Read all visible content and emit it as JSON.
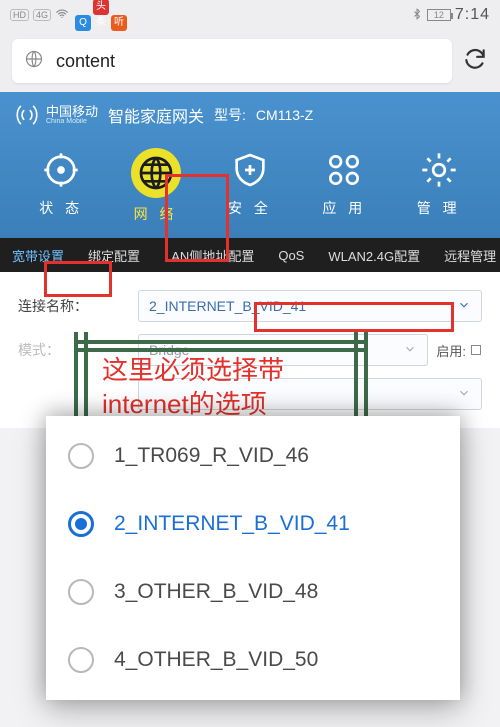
{
  "statusbar": {
    "hd": "HD",
    "net": "4G",
    "battery": "12",
    "time": "7:14"
  },
  "browser": {
    "url_text": "content"
  },
  "router": {
    "carrier_cn": "中国移动",
    "carrier_en": "China Mobile",
    "product": "智能家庭网关",
    "model_label": "型号:",
    "model": "CM113-Z",
    "nav": {
      "status": "状 态",
      "network": "网 络",
      "security": "安 全",
      "apps": "应 用",
      "manage": "管 理"
    }
  },
  "tabs": {
    "broadband": "宽带设置",
    "bind": "绑定配置",
    "lan": "LAN侧地址配置",
    "qos": "QoS",
    "wlan": "WLAN2.4G配置",
    "remote": "远程管理"
  },
  "form": {
    "conn_label": "连接名称：",
    "conn_value": "2_INTERNET_B_VID_41",
    "mode_label": "模式：",
    "mode_value": "Bridge",
    "enable_label": "启用:"
  },
  "annotation": {
    "line1": "这里必须选择带",
    "line2": "internet的选项"
  },
  "options": [
    {
      "label": "1_TR069_R_VID_46",
      "selected": false
    },
    {
      "label": "2_INTERNET_B_VID_41",
      "selected": true
    },
    {
      "label": "3_OTHER_B_VID_48",
      "selected": false
    },
    {
      "label": "4_OTHER_B_VID_50",
      "selected": false
    }
  ]
}
